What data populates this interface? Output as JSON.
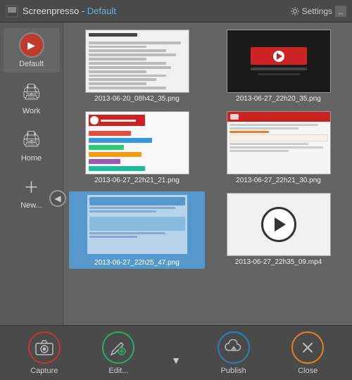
{
  "titleBar": {
    "appName": "Screenpresso",
    "separator": " - ",
    "profileName": "Default",
    "settingsLabel": "Settings",
    "minLabel": "_",
    "closeLabel": "×"
  },
  "sidebar": {
    "items": [
      {
        "id": "default",
        "label": "Default",
        "type": "profile-default"
      },
      {
        "id": "work",
        "label": "Work",
        "type": "printer"
      },
      {
        "id": "home",
        "label": "Home",
        "type": "printer"
      },
      {
        "id": "new",
        "label": "New...",
        "type": "plus"
      }
    ],
    "navArrow": "◀"
  },
  "thumbnails": [
    {
      "id": "t1",
      "label": "2013-06-20_08h42_35.png",
      "type": "doc",
      "selected": false
    },
    {
      "id": "t2",
      "label": "2013-06-27_22h20_35.png",
      "type": "logo",
      "selected": false
    },
    {
      "id": "t3",
      "label": "2013-06-27_22h21_21.png",
      "type": "chart",
      "selected": false
    },
    {
      "id": "t4",
      "label": "2013-06-27_22h21_30.png",
      "type": "web",
      "selected": false
    },
    {
      "id": "t5",
      "label": "2013-06-27_22h25_47.png",
      "type": "selected-preview",
      "selected": true
    },
    {
      "id": "t6",
      "label": "2013-06-27_22h35_09.mp4",
      "type": "video",
      "selected": false
    }
  ],
  "bottomBar": {
    "captureLabel": "Capture",
    "editLabel": "Edit...",
    "publishLabel": "Publish",
    "closeLabel": "Close"
  }
}
